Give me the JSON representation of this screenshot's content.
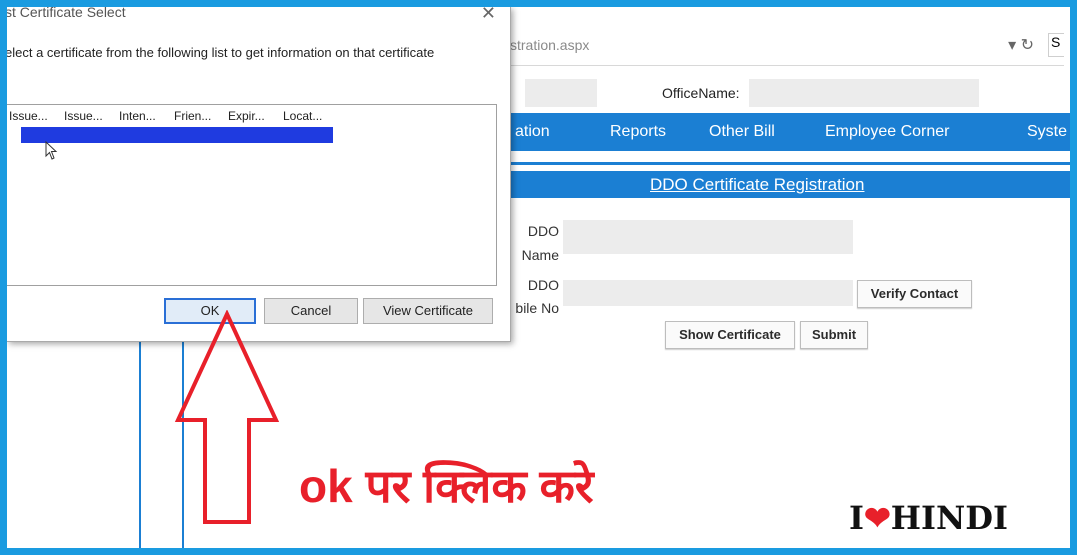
{
  "browser": {
    "url_text": "stration.aspx",
    "controls": "▾ ↻",
    "tab_glyph": "S"
  },
  "header": {
    "office_label": "OfficeName:"
  },
  "nav": {
    "items": [
      "ation",
      "Reports",
      "Other Bill",
      "Employee Corner",
      "Syste"
    ]
  },
  "section": {
    "title": "DDO Certificate Registration"
  },
  "form": {
    "ddo_name_label_1": "DDO",
    "ddo_name_label_2": "Name",
    "ddo_mobile_label_1": "DDO",
    "ddo_mobile_label_2": "bile No",
    "verify_button": "Verify Contact",
    "show_cert_button": "Show Certificate",
    "submit_button": "Submit"
  },
  "dialog": {
    "title": "st Certificate Select",
    "close_glyph": "✕",
    "instruction": "elect a certificate from the following list to get information on that certificate",
    "columns": [
      "Issue...",
      "Issue...",
      "Inten...",
      "Frien...",
      "Expir...",
      "Locat..."
    ],
    "ok_button": "OK",
    "cancel_button": "Cancel",
    "view_button": "View Certificate"
  },
  "annotation": {
    "text": "ok पर क्लिक करे"
  },
  "logo": {
    "left": "I",
    "heart": "❤",
    "right": "HINDI"
  },
  "colors": {
    "frame": "#1a9be0",
    "nav": "#1b7fd3",
    "arrow": "#e8202a"
  }
}
